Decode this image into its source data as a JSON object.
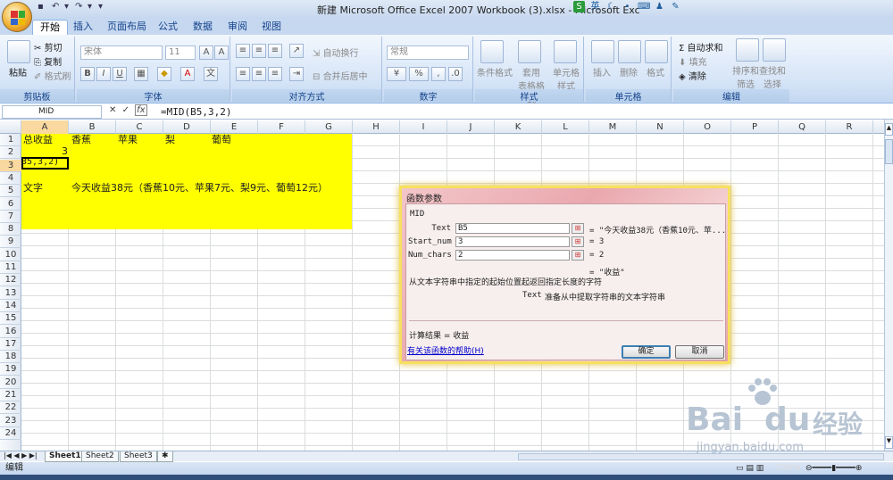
{
  "window": {
    "title": "新建 Microsoft Office Excel 2007 Workbook (3).xlsx - Microsoft Exc",
    "tray_icons": [
      "app-s-icon",
      "ime-ying-icon",
      "moon-icon",
      "dot-icon",
      "keyboard-icon",
      "user-icon",
      "wrench-icon"
    ],
    "tray_label": "英"
  },
  "ribbon_tabs": [
    "开始",
    "插入",
    "页面布局",
    "公式",
    "数据",
    "审阅",
    "视图"
  ],
  "active_tab": "开始",
  "clipboard": {
    "paste": "粘贴",
    "cut": "剪切",
    "copy": "复制",
    "format_painter": "格式刷",
    "label": "剪贴板"
  },
  "font": {
    "name": "宋体",
    "size": "11",
    "label": "字体",
    "bold": "B",
    "italic": "I",
    "underline": "U",
    "wen": "文"
  },
  "alignment": {
    "wrap": "自动换行",
    "merge": "合并后居中",
    "label": "对齐方式"
  },
  "number": {
    "format": "常规",
    "percent": "%",
    "comma": ",",
    "label": "数字"
  },
  "styles": {
    "cond": "条件格式",
    "table": "套用\n表格格式",
    "cell_style": "单元格\n样式",
    "label": "样式"
  },
  "cells": {
    "insert": "插入",
    "delete": "删除",
    "format": "格式",
    "label": "单元格"
  },
  "editing": {
    "autosum": "自动求和",
    "fill": "填充",
    "clear": "清除",
    "sort": "排序和\n筛选",
    "find": "查找和\n选择",
    "label": "编辑"
  },
  "formula_bar": {
    "name_box": "MID",
    "formula": "=MID(B5,3,2)",
    "fx": "fx"
  },
  "columns": [
    "A",
    "B",
    "C",
    "D",
    "E",
    "F",
    "G",
    "H",
    "I",
    "J",
    "K",
    "L",
    "M",
    "N",
    "O",
    "P",
    "Q",
    "R"
  ],
  "rows": [
    "1",
    "2",
    "3",
    "4",
    "5",
    "6",
    "7",
    "8",
    "9",
    "10",
    "11",
    "12",
    "13",
    "14",
    "15",
    "16",
    "17",
    "18",
    "19",
    "20",
    "21",
    "22",
    "23",
    "24"
  ],
  "sheet": {
    "a1": "总收益",
    "b1": "香蕉",
    "c1": "苹果",
    "d1": "梨",
    "e1": "葡萄",
    "a2": "3",
    "a3": "35,3,2)",
    "a5": "文字",
    "b5": "今天收益38元（香蕉10元、苹果7元、梨9元、葡萄12元）"
  },
  "sheet_tabs": [
    "Sheet1",
    "Sheet2",
    "Sheet3"
  ],
  "status": {
    "mode": "编辑",
    "zoom": "100%"
  },
  "dialog": {
    "title": "函数参数",
    "function": "MID",
    "args": [
      {
        "label": "Text",
        "value": "B5",
        "result": "= \"今天收益38元（香蕉10元、苹..."
      },
      {
        "label": "Start_num",
        "value": "3",
        "result": "= 3"
      },
      {
        "label": "Num_chars",
        "value": "2",
        "result": "= 2"
      }
    ],
    "overall": "= \"收益\"",
    "description": "从文本字符串中指定的起始位置起返回指定长度的字符",
    "arg_help_name": "Text",
    "arg_help": "准备从中提取字符串的文本字符串",
    "result_label": "计算结果 = 收益",
    "help_link": "有关该函数的帮助(H)",
    "ok": "确定",
    "cancel": "取消"
  },
  "watermark": {
    "brand": "Bai",
    "brand2": "du",
    "cn": "经验",
    "url": "jingyan.baidu.com"
  }
}
